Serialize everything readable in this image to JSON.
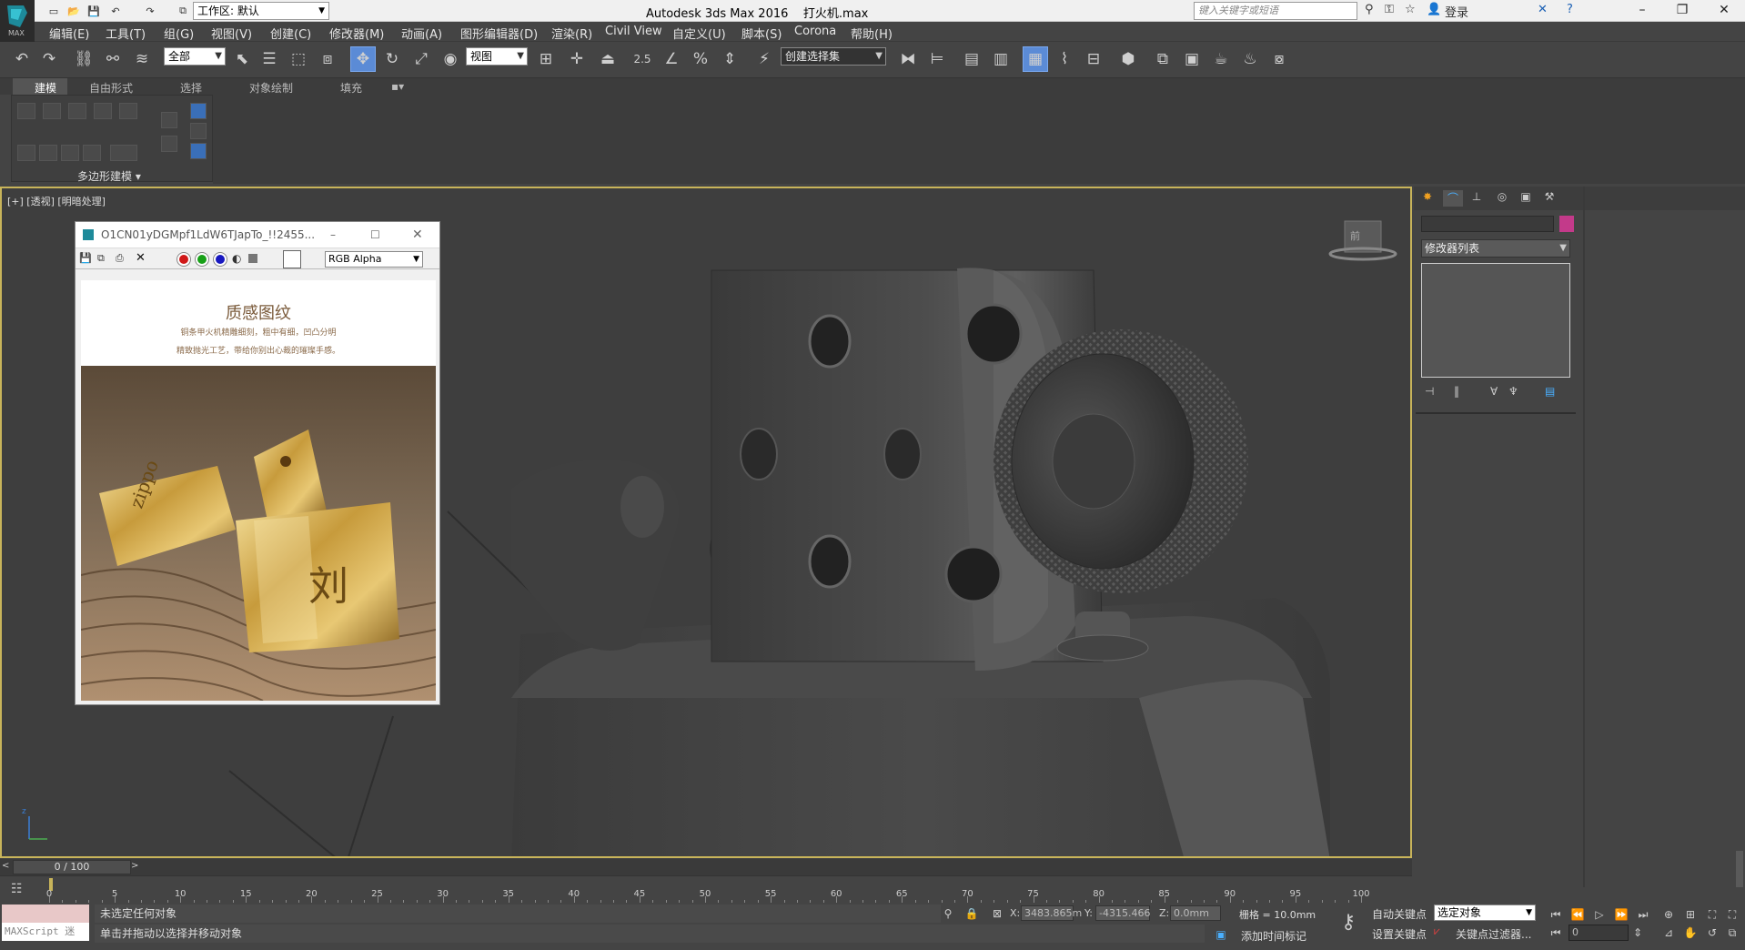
{
  "title_bar": {
    "workspace_label": "工作区: 默认",
    "app_title": "Autodesk 3ds Max 2016",
    "file_name": "打火机.max",
    "search_placeholder": "键入关键字或短语",
    "login_label": "登录"
  },
  "logo": {
    "label": "MAX"
  },
  "menu": {
    "items": [
      "编辑(E)",
      "工具(T)",
      "组(G)",
      "视图(V)",
      "创建(C)",
      "修改器(M)",
      "动画(A)",
      "图形编辑器(D)",
      "渲染(R)",
      "Civil View",
      "自定义(U)",
      "脚本(S)",
      "Corona",
      "帮助(H)"
    ]
  },
  "toolbar": {
    "selection_filter": "全部",
    "reference_coord": "视图",
    "snap_value": "2.5",
    "named_selection": "创建选择集"
  },
  "ribbon": {
    "tabs": [
      "建模",
      "自由形式",
      "选择",
      "对象绘制",
      "填充"
    ],
    "active_tab": "建模",
    "panel_label": "多边形建模"
  },
  "viewport": {
    "label": "[+] [透视] [明暗处理]",
    "viewcube_label": "前"
  },
  "render_window": {
    "title": "O1CN01yDGMpf1LdW6TJapTo_!!2455...",
    "channel": "RGB Alpha",
    "image": {
      "heading": "质感图纹",
      "line1": "铜条甲火机精雕细刻，粗中有细，凹凸分明",
      "line2": "精致抛光工艺，带给你别出心裁的璀璨手感。",
      "brand": "zippo",
      "emblem": "刘"
    }
  },
  "command_panel": {
    "modifier_list": "修改器列表",
    "color_swatch": "#c33a8a"
  },
  "timeline": {
    "frame_display": "0 / 100",
    "ticks": [
      0,
      5,
      10,
      15,
      20,
      25,
      30,
      35,
      40,
      45,
      50,
      55,
      60,
      65,
      70,
      75,
      80,
      85,
      90,
      95,
      100
    ]
  },
  "status": {
    "maxscript_label": "MAXScript 迷",
    "line1": "未选定任何对象",
    "line2": "单击并拖动以选择并移动对象",
    "x_value": "3483.865m",
    "y_value": "-4315.466",
    "z_value": "0.0mm",
    "grid": "栅格 = 10.0mm",
    "add_time_tag": "添加时间标记",
    "auto_key": "自动关键点",
    "set_key": "设置关键点",
    "selected_object": "选定对象",
    "key_filters": "关键点过滤器...",
    "frame_field": "0",
    "x_label": "X:",
    "y_label": "Y:",
    "z_label": "Z:"
  }
}
